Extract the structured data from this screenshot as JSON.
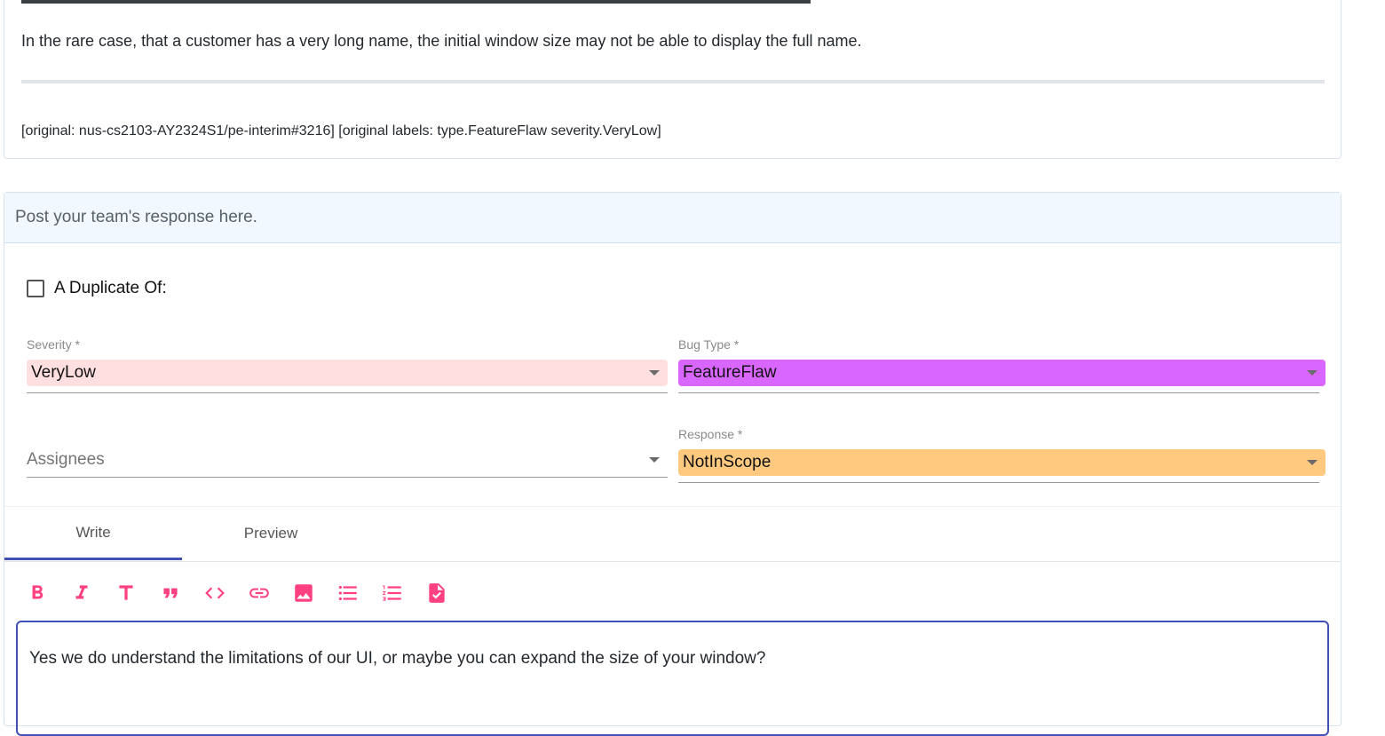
{
  "issue": {
    "body": "In the rare case, that a customer has a very long name, the initial window size may not be able to display the full name.",
    "original_note": "[original: nus-cs2103-AY2324S1/pe-interim#3216] [original labels: type.FeatureFlaw severity.VeryLow]"
  },
  "response": {
    "header": "Post your team's response here.",
    "duplicate_label": "A Duplicate Of:",
    "duplicate_checked": false,
    "severity": {
      "label": "Severity *",
      "value": "VeryLow",
      "color": "#ffdfdf"
    },
    "bug_type": {
      "label": "Bug Type *",
      "value": "FeatureFlaw",
      "color": "#d966ff"
    },
    "assignees": {
      "placeholder": "Assignees"
    },
    "response_type": {
      "label": "Response *",
      "value": "NotInScope",
      "color": "#ffca7f"
    },
    "tabs": [
      {
        "label": "Write",
        "active": true
      },
      {
        "label": "Preview",
        "active": false
      }
    ],
    "toolbar": [
      {
        "icon": "bold-icon"
      },
      {
        "icon": "italic-icon"
      },
      {
        "icon": "heading-icon"
      },
      {
        "icon": "quote-icon"
      },
      {
        "icon": "code-icon"
      },
      {
        "icon": "link-icon"
      },
      {
        "icon": "image-icon"
      },
      {
        "icon": "bulleted-list-icon"
      },
      {
        "icon": "numbered-list-icon"
      },
      {
        "icon": "task-list-icon"
      }
    ],
    "editor_text": "Yes we do understand the limitations of our UI, or maybe you can expand the size of your window?",
    "accent_color": "#3f51b5",
    "toolbar_color": "#ff4081"
  }
}
